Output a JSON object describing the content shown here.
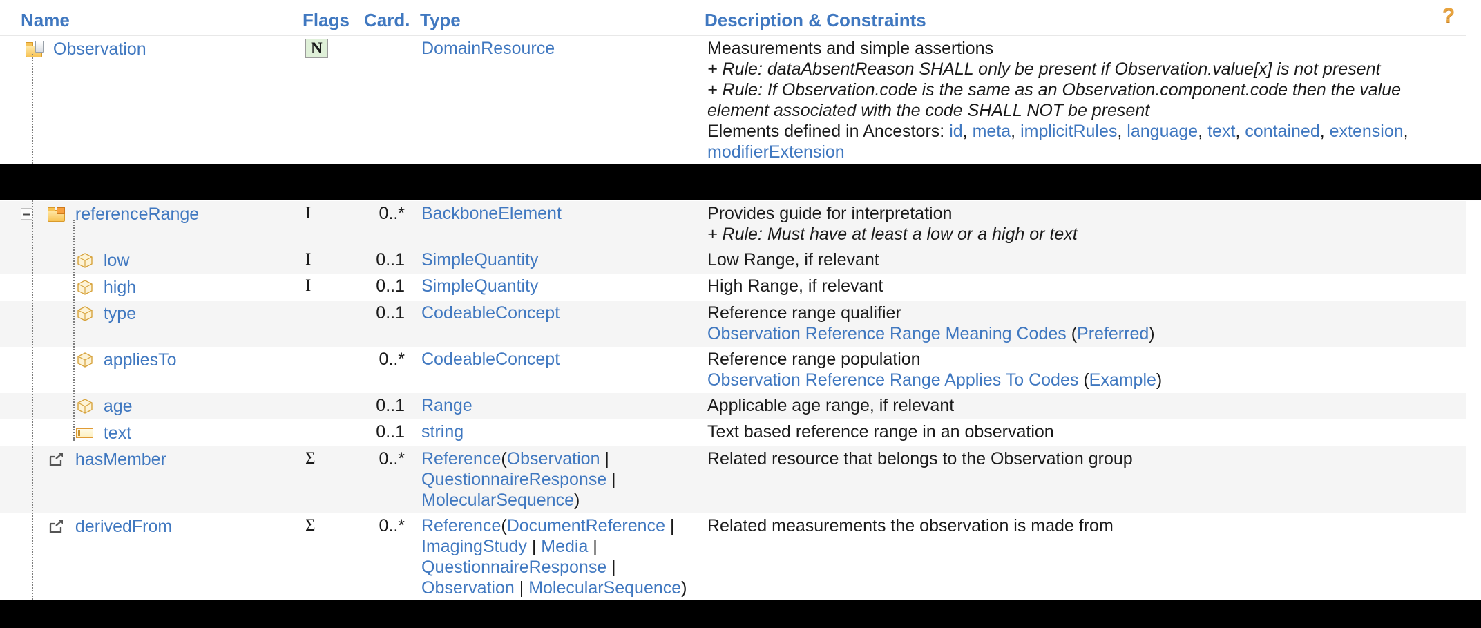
{
  "table": {
    "columns": {
      "name": "Name",
      "flags": "Flags",
      "card": "Card.",
      "type": "Type",
      "desc": "Description & Constraints"
    },
    "help_icon": "?",
    "colors": {
      "link": "#4078c0",
      "header": "#4078c0",
      "stripe": "#f5f5f5",
      "flag_badge_bg": "#dff0d8",
      "icon_gold": "#f7c355"
    }
  },
  "rows": [
    {
      "name": "Observation",
      "icon": "resource-icon",
      "flags": "N",
      "flag_badge": true,
      "card": "",
      "type": [
        {
          "t": "DomainResource",
          "link": true
        }
      ],
      "desc_lines": [
        {
          "style": "plain",
          "parts": [
            {
              "t": "Measurements and simple assertions",
              "link": false
            }
          ]
        },
        {
          "style": "rule",
          "parts": [
            {
              "t": "+ Rule: dataAbsentReason SHALL only be present if Observation.value[x] is not present",
              "link": false
            }
          ]
        },
        {
          "style": "rule",
          "parts": [
            {
              "t": "+ Rule: If Observation.code is the same as an Observation.component.code then the value element associated with the code SHALL NOT be present",
              "link": false
            }
          ]
        },
        {
          "style": "plain",
          "parts": [
            {
              "t": "Elements defined in Ancestors: ",
              "link": false
            },
            {
              "t": "id",
              "link": true
            },
            {
              "t": ", ",
              "link": false
            },
            {
              "t": "meta",
              "link": true
            },
            {
              "t": ", ",
              "link": false
            },
            {
              "t": "implicitRules",
              "link": true
            },
            {
              "t": ", ",
              "link": false
            },
            {
              "t": "language",
              "link": true
            },
            {
              "t": ", ",
              "link": false
            },
            {
              "t": "text",
              "link": true
            },
            {
              "t": ", ",
              "link": false
            },
            {
              "t": "contained",
              "link": true
            },
            {
              "t": ", ",
              "link": false
            },
            {
              "t": "extension",
              "link": true
            },
            {
              "t": ", ",
              "link": false
            },
            {
              "t": "modifierExtension",
              "link": true
            }
          ]
        }
      ]
    },
    {
      "name": "referenceRange",
      "icon": "folder-icon",
      "expander": "minus",
      "flags": "I",
      "card": "0..*",
      "type": [
        {
          "t": "BackboneElement",
          "link": true
        }
      ],
      "desc_lines": [
        {
          "style": "plain",
          "parts": [
            {
              "t": "Provides guide for interpretation",
              "link": false
            }
          ]
        },
        {
          "style": "rule",
          "parts": [
            {
              "t": "+ Rule: Must have at least a low or a high or text",
              "link": false
            }
          ]
        }
      ]
    },
    {
      "name": "low",
      "icon": "datatype-icon",
      "flags": "I",
      "card": "0..1",
      "type": [
        {
          "t": "SimpleQuantity",
          "link": true
        }
      ],
      "desc_lines": [
        {
          "style": "plain",
          "parts": [
            {
              "t": "Low Range, if relevant",
              "link": false
            }
          ]
        }
      ]
    },
    {
      "name": "high",
      "icon": "datatype-icon",
      "flags": "I",
      "card": "0..1",
      "type": [
        {
          "t": "SimpleQuantity",
          "link": true
        }
      ],
      "desc_lines": [
        {
          "style": "plain",
          "parts": [
            {
              "t": "High Range, if relevant",
              "link": false
            }
          ]
        }
      ]
    },
    {
      "name": "type",
      "icon": "datatype-icon",
      "flags": "",
      "card": "0..1",
      "type": [
        {
          "t": "CodeableConcept",
          "link": true
        }
      ],
      "desc_lines": [
        {
          "style": "plain",
          "parts": [
            {
              "t": "Reference range qualifier",
              "link": false
            }
          ]
        },
        {
          "style": "plain",
          "parts": [
            {
              "t": "Observation Reference Range Meaning Codes",
              "link": true
            },
            {
              "t": " (",
              "link": false
            },
            {
              "t": "Preferred",
              "link": true
            },
            {
              "t": ")",
              "link": false
            }
          ]
        }
      ]
    },
    {
      "name": "appliesTo",
      "icon": "datatype-icon",
      "flags": "",
      "card": "0..*",
      "type": [
        {
          "t": "CodeableConcept",
          "link": true
        }
      ],
      "desc_lines": [
        {
          "style": "plain",
          "parts": [
            {
              "t": "Reference range population",
              "link": false
            }
          ]
        },
        {
          "style": "plain",
          "parts": [
            {
              "t": "Observation Reference Range Applies To Codes",
              "link": true
            },
            {
              "t": " (",
              "link": false
            },
            {
              "t": "Example",
              "link": true
            },
            {
              "t": ")",
              "link": false
            }
          ]
        }
      ]
    },
    {
      "name": "age",
      "icon": "datatype-icon",
      "flags": "",
      "card": "0..1",
      "type": [
        {
          "t": "Range",
          "link": true
        }
      ],
      "desc_lines": [
        {
          "style": "plain",
          "parts": [
            {
              "t": "Applicable age range, if relevant",
              "link": false
            }
          ]
        }
      ]
    },
    {
      "name": "text",
      "icon": "primitive-icon",
      "flags": "",
      "card": "0..1",
      "type": [
        {
          "t": "string",
          "link": true
        }
      ],
      "desc_lines": [
        {
          "style": "plain",
          "parts": [
            {
              "t": "Text based reference range in an observation",
              "link": false
            }
          ]
        }
      ]
    },
    {
      "name": "hasMember",
      "icon": "reference-icon",
      "flags": "Σ",
      "card": "0..*",
      "type": [
        {
          "t": "Reference",
          "link": true
        },
        {
          "t": "(",
          "link": false
        },
        {
          "t": "Observation",
          "link": true
        },
        {
          "t": " | ",
          "link": false
        },
        {
          "t": "QuestionnaireResponse",
          "link": true
        },
        {
          "t": " | ",
          "link": false
        },
        {
          "t": "MolecularSequence",
          "link": true
        },
        {
          "t": ")",
          "link": false
        }
      ],
      "desc_lines": [
        {
          "style": "plain",
          "parts": [
            {
              "t": "Related resource that belongs to the Observation group",
              "link": false
            }
          ]
        }
      ]
    },
    {
      "name": "derivedFrom",
      "icon": "reference-icon",
      "flags": "Σ",
      "card": "0..*",
      "type": [
        {
          "t": "Reference",
          "link": true
        },
        {
          "t": "(",
          "link": false
        },
        {
          "t": "DocumentReference",
          "link": true
        },
        {
          "t": " | ",
          "link": false
        },
        {
          "t": "ImagingStudy",
          "link": true
        },
        {
          "t": " | ",
          "link": false
        },
        {
          "t": "Media",
          "link": true
        },
        {
          "t": " | ",
          "link": false
        },
        {
          "t": "QuestionnaireResponse",
          "link": true
        },
        {
          "t": " | ",
          "link": false
        },
        {
          "t": "Observation",
          "link": true
        },
        {
          "t": " | ",
          "link": false
        },
        {
          "t": "MolecularSequence",
          "link": true
        },
        {
          "t": ")",
          "link": false
        }
      ],
      "desc_lines": [
        {
          "style": "plain",
          "parts": [
            {
              "t": "Related measurements the observation is made from",
              "link": false
            }
          ]
        }
      ]
    }
  ]
}
